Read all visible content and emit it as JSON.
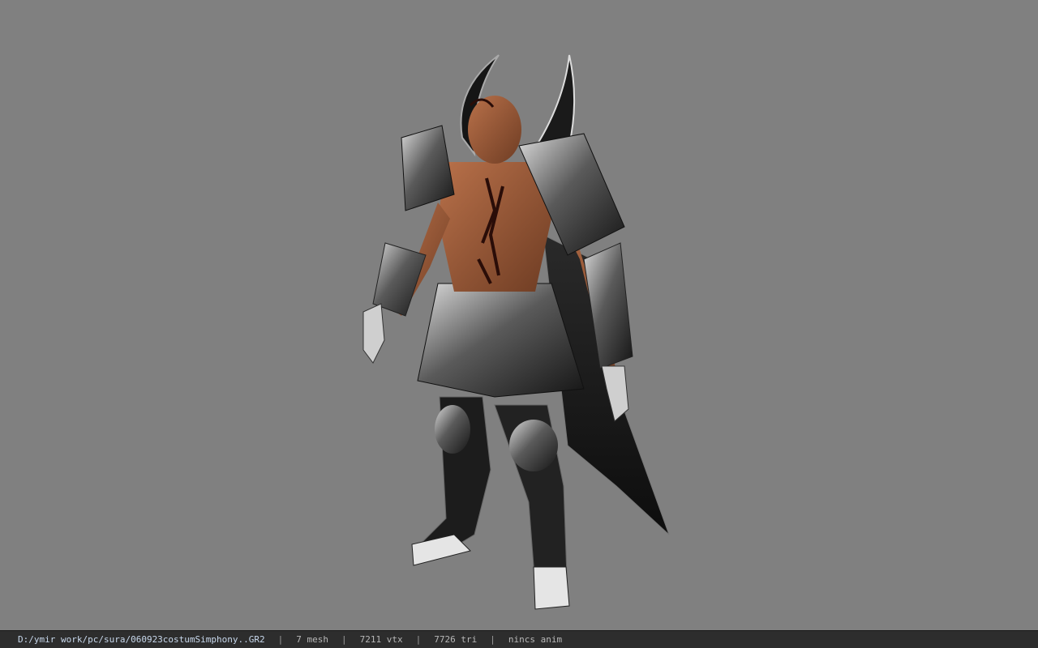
{
  "viewer": {
    "background_color": "#808080",
    "model_icon": "armored-character-model"
  },
  "status_bar": {
    "file_path": "D:/ymir work/pc/sura/060923costumSimphony..GR2",
    "separator": "|",
    "mesh_count": "7 mesh",
    "vertex_count": "7211 vtx",
    "triangle_count": "7726 tri",
    "animation": "nincs anim"
  }
}
